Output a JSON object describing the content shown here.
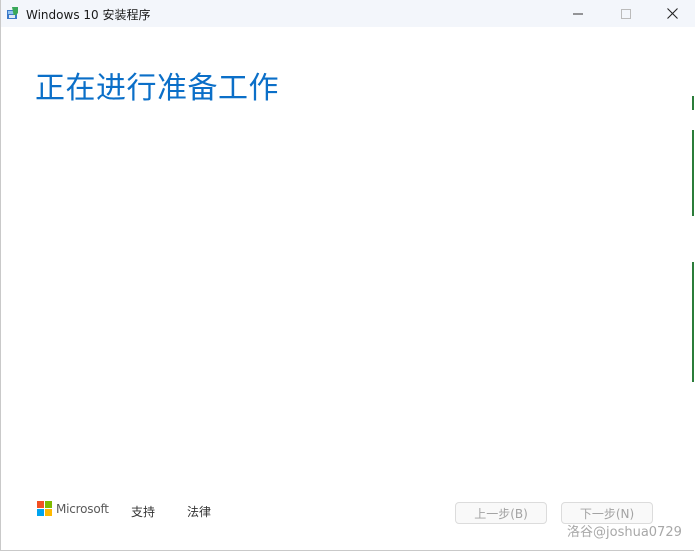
{
  "window": {
    "title": "Windows 10 安装程序",
    "icon": "setup-app-icon",
    "controls": [
      "minimize-icon",
      "maximize-icon",
      "close-icon"
    ]
  },
  "main": {
    "heading": "正在进行准备工作"
  },
  "footer": {
    "brand": "Microsoft",
    "links": {
      "support": "支持",
      "legal": "法律"
    },
    "buttons": {
      "back": "上一步(B)",
      "next": "下一步(N)"
    }
  },
  "watermark": "洛谷@joshua0729",
  "colors": {
    "heading": "#0b6fc8",
    "titlebar": "#f3f6fb",
    "ms_red": "#f25022",
    "ms_green": "#7fba00",
    "ms_blue": "#00a4ef",
    "ms_yellow": "#ffb900"
  }
}
